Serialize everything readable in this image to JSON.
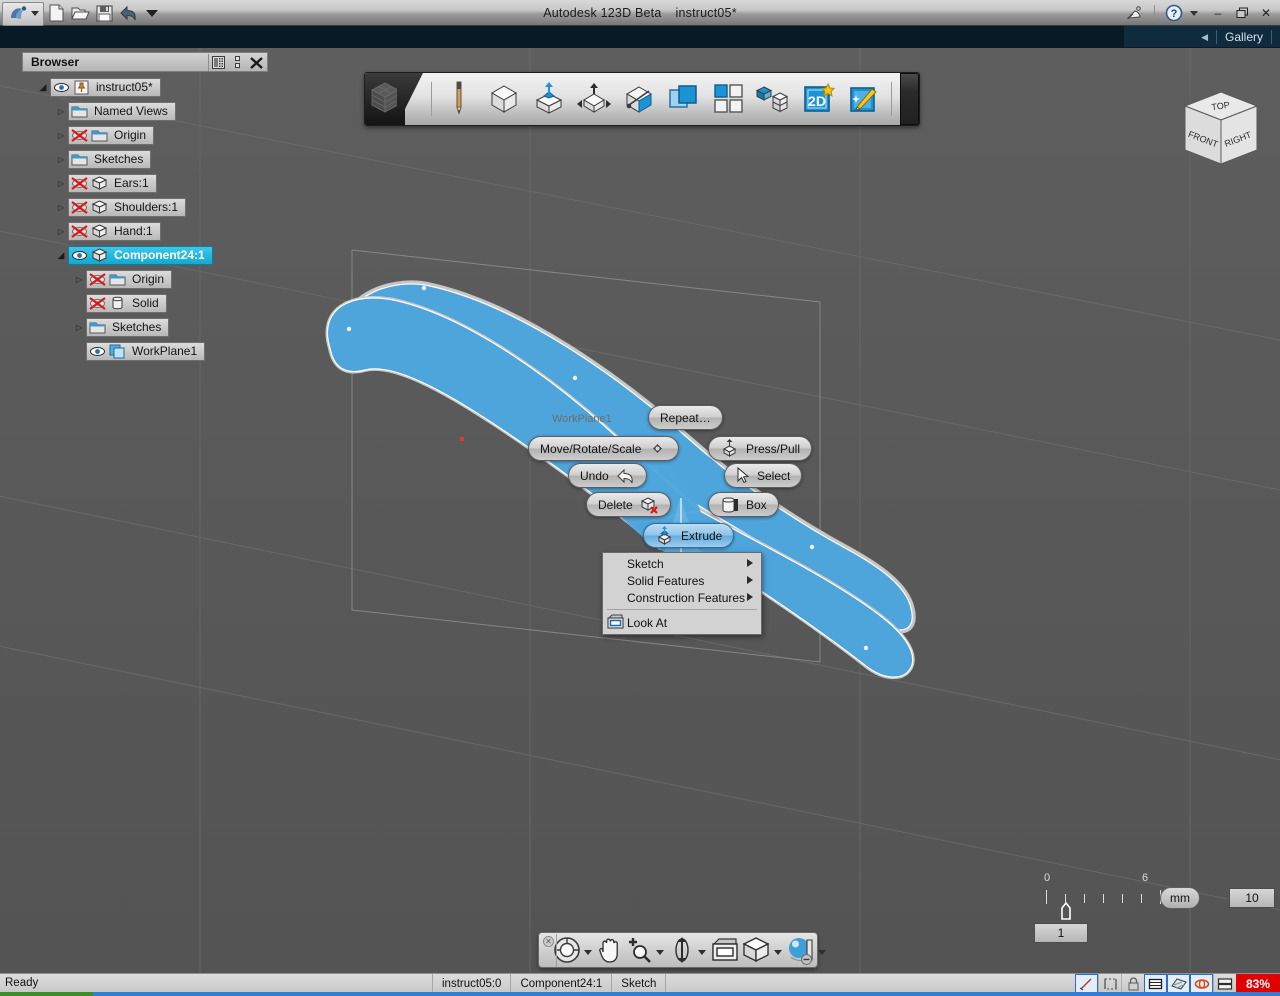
{
  "titlebar": {
    "app_title": "Autodesk 123D Beta",
    "document_name": "instruct05*",
    "buttons": [
      {
        "name": "app-menu-orb",
        "label": "123D"
      },
      {
        "name": "new-document-button",
        "label": "New"
      },
      {
        "name": "open-document-button",
        "label": "Open"
      },
      {
        "name": "save-document-button",
        "label": "Save"
      },
      {
        "name": "undo-button",
        "label": "Undo"
      },
      {
        "name": "quick-access-dropdown",
        "label": "More"
      }
    ],
    "help_label": "?",
    "minimize_label": "–",
    "restore_label": "❐",
    "close_label": "✕"
  },
  "gallerybar": {
    "collapse_arrow": "◀",
    "gallery_label": "Gallery"
  },
  "browser": {
    "title": "Browser",
    "header_buttons": [
      {
        "name": "browser-layout-button",
        "label": "▦"
      },
      {
        "name": "browser-dock-button",
        "label": "☰"
      },
      {
        "name": "browser-close-button",
        "label": "✕"
      }
    ],
    "tree": [
      {
        "label": "instruct05*",
        "indent": 0,
        "twisty": "open",
        "icons": [
          "eye",
          "pin"
        ],
        "selected": false
      },
      {
        "label": "Named Views",
        "indent": 1,
        "twisty": "closed",
        "icons": [
          "folder"
        ],
        "selected": false
      },
      {
        "label": "Origin",
        "indent": 1,
        "twisty": "closed",
        "icons": [
          "eye-off",
          "folder"
        ],
        "selected": false
      },
      {
        "label": "Sketches",
        "indent": 1,
        "twisty": "closed",
        "icons": [
          "folder"
        ],
        "selected": false
      },
      {
        "label": "Ears:1",
        "indent": 1,
        "twisty": "closed",
        "icons": [
          "eye-off",
          "cube"
        ],
        "selected": false
      },
      {
        "label": "Shoulders:1",
        "indent": 1,
        "twisty": "closed",
        "icons": [
          "eye-off",
          "cube"
        ],
        "selected": false
      },
      {
        "label": "Hand:1",
        "indent": 1,
        "twisty": "closed",
        "icons": [
          "eye-off",
          "cube"
        ],
        "selected": false
      },
      {
        "label": "Component24:1",
        "indent": 1,
        "twisty": "open",
        "icons": [
          "eye",
          "cube"
        ],
        "selected": true
      },
      {
        "label": "Origin",
        "indent": 2,
        "twisty": "closed",
        "icons": [
          "eye-off",
          "folder"
        ],
        "selected": false
      },
      {
        "label": "Solid",
        "indent": 2,
        "twisty": "none",
        "icons": [
          "eye-off",
          "cylinder"
        ],
        "selected": false
      },
      {
        "label": "Sketches",
        "indent": 2,
        "twisty": "closed",
        "icons": [
          "folder"
        ],
        "selected": false
      },
      {
        "label": "WorkPlane1",
        "indent": 2,
        "twisty": "none",
        "icons": [
          "eye",
          "workplane"
        ],
        "selected": false
      }
    ]
  },
  "maintoolbar": {
    "logo_name": "123d-cube-logo",
    "items": [
      {
        "name": "sketch-pencil-tool",
        "label": "Sketch"
      },
      {
        "name": "primitives-tool",
        "label": "Primitives"
      },
      {
        "name": "construct-extrude-tool",
        "label": "Construct"
      },
      {
        "name": "modify-tool",
        "label": "Modify"
      },
      {
        "name": "pattern-tool",
        "label": "Pattern"
      },
      {
        "name": "combine-tool",
        "label": "Combine"
      },
      {
        "name": "grouping-tool",
        "label": "Grouping"
      },
      {
        "name": "assemble-tool",
        "label": "Assemble"
      },
      {
        "name": "drawing-2d-tool",
        "label": "2D"
      },
      {
        "name": "smart-tool",
        "label": "Smart"
      }
    ]
  },
  "viewcube": {
    "top_face": "TOP",
    "front_face": "FRONT",
    "right_face": "RIGHT"
  },
  "viewport": {
    "workplane_label": "WorkPlane1"
  },
  "marking_menu": {
    "items": [
      {
        "name": "marking-menu-repeat",
        "label": "Repeat…",
        "icon": "none",
        "active": false
      },
      {
        "name": "marking-menu-move-rotate-scale",
        "label": "Move/Rotate/Scale",
        "icon": "move-icon",
        "active": false
      },
      {
        "name": "marking-menu-press-pull",
        "label": "Press/Pull",
        "icon": "press-pull-icon",
        "active": false
      },
      {
        "name": "marking-menu-undo",
        "label": "Undo",
        "icon": "undo-arrow-icon",
        "active": false
      },
      {
        "name": "marking-menu-select",
        "label": "Select",
        "icon": "cursor-icon",
        "active": false
      },
      {
        "name": "marking-menu-delete",
        "label": "Delete",
        "icon": "delete-cube-icon",
        "active": false
      },
      {
        "name": "marking-menu-box",
        "label": "Box",
        "icon": "box-icon",
        "active": false
      },
      {
        "name": "marking-menu-extrude",
        "label": "Extrude",
        "icon": "extrude-icon",
        "active": true
      }
    ]
  },
  "context_menu": {
    "items": [
      {
        "name": "context-menu-sketch",
        "label": "Sketch",
        "submenu": true,
        "icon": "none"
      },
      {
        "name": "context-menu-solid-features",
        "label": "Solid Features",
        "submenu": true,
        "icon": "none"
      },
      {
        "name": "context-menu-construction-features",
        "label": "Construction Features",
        "submenu": true,
        "icon": "none"
      },
      {
        "name": "context-menu-look-at",
        "label": "Look At",
        "submenu": false,
        "icon": "look-at-icon"
      }
    ]
  },
  "ruler": {
    "tick_labels": [
      "0",
      "6"
    ],
    "unit_label": "mm",
    "grid_value": "10",
    "scale_value": "1"
  },
  "navbar": {
    "close_label": "✕",
    "minimize_label": "⊖",
    "items": [
      {
        "name": "steering-wheel-button",
        "label": "SteeringWheels",
        "caret": true
      },
      {
        "name": "pan-button",
        "label": "Pan",
        "caret": false
      },
      {
        "name": "zoom-button",
        "label": "Zoom",
        "caret": true
      },
      {
        "name": "orbit-button",
        "label": "Orbit",
        "caret": true
      },
      {
        "name": "look-at-button",
        "label": "Look At",
        "caret": false
      },
      {
        "name": "view-cube-button",
        "label": "View",
        "caret": true
      },
      {
        "name": "material-button",
        "label": "Material",
        "caret": true
      }
    ]
  },
  "statusbar": {
    "status_text": "Ready",
    "cells": [
      "instruct05:0",
      "Component24:1",
      "Sketch"
    ],
    "toggles": [
      {
        "name": "status-snap-toggle",
        "label": "snap-icon",
        "on": true
      },
      {
        "name": "status-constraint-toggle",
        "label": "constraint-icon",
        "on": false
      },
      {
        "name": "status-lock-toggle",
        "label": "lock-icon",
        "on": false
      },
      {
        "name": "status-grid-toggle",
        "label": "grid-icon",
        "on": true
      },
      {
        "name": "status-plane-toggle",
        "label": "plane-icon",
        "on": true
      },
      {
        "name": "status-sketch-toggle",
        "label": "sketch-visibility-icon",
        "on": true
      },
      {
        "name": "status-display-toggle",
        "label": "display-icon",
        "on": false
      }
    ],
    "percentage": "83%"
  }
}
